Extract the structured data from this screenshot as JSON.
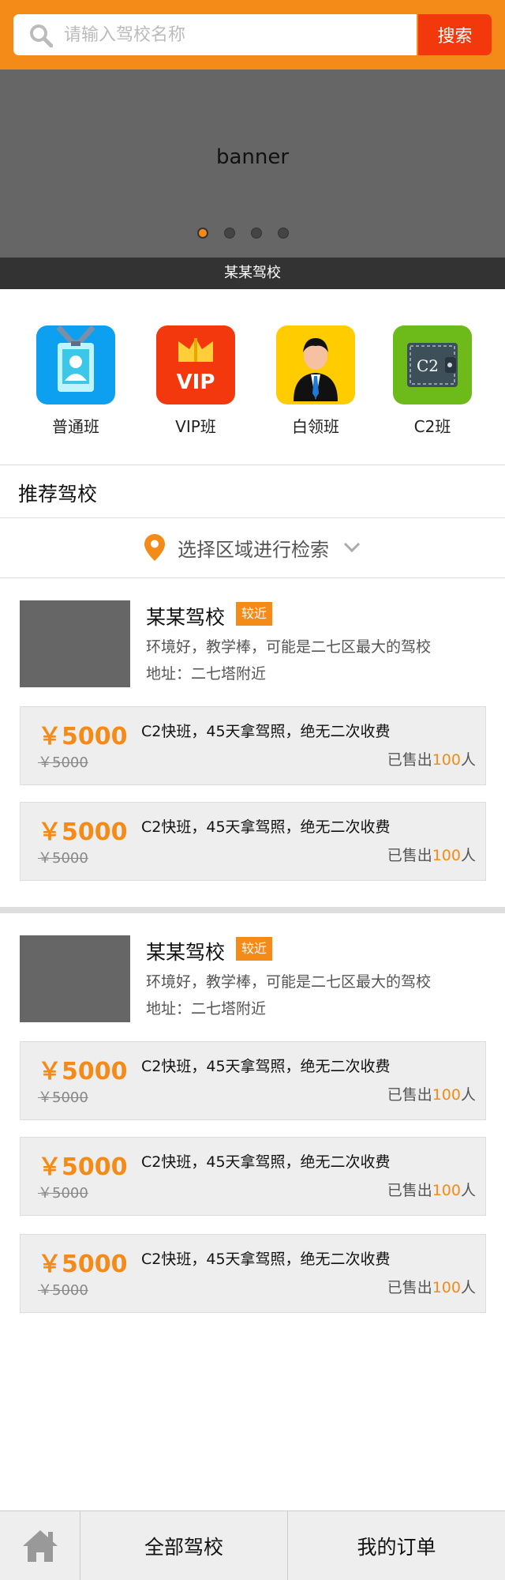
{
  "search": {
    "placeholder": "请输入驾校名称",
    "button_label": "搜索"
  },
  "banner": {
    "text": "banner",
    "caption": "某某驾校",
    "dot_count": 4,
    "active_dot": 1
  },
  "categories": [
    {
      "label": "普通班",
      "icon": "id-badge-icon",
      "color": "#0ea0f0"
    },
    {
      "label": "VIP班",
      "icon": "vip-crown-icon",
      "icon_text": "VIP",
      "color": "#f4380e"
    },
    {
      "label": "白领班",
      "icon": "businessman-icon",
      "color": "#ffcc00"
    },
    {
      "label": "C2班",
      "icon": "c2-wallet-icon",
      "icon_text": "C2",
      "color": "#6cbb1a"
    }
  ],
  "recommend": {
    "title": "推荐驾校"
  },
  "area_filter": {
    "label": "选择区域进行检索"
  },
  "schools": [
    {
      "name": "某某驾校",
      "badge": "较近",
      "desc": "环境好，教学棒，可能是二七区最大的驾校",
      "address": "地址：二七塔附近",
      "offers": [
        {
          "price": "￥5000",
          "old_price": "￥5000",
          "title": "C2快班，45天拿驾照，绝无二次收费",
          "sold_prefix": "已售出",
          "sold_count": "100",
          "sold_suffix": "人"
        },
        {
          "price": "￥5000",
          "old_price": "￥5000",
          "title": "C2快班，45天拿驾照，绝无二次收费",
          "sold_prefix": "已售出",
          "sold_count": "100",
          "sold_suffix": "人"
        }
      ]
    },
    {
      "name": "某某驾校",
      "badge": "较近",
      "desc": "环境好，教学棒，可能是二七区最大的驾校",
      "address": "地址：二七塔附近",
      "offers": [
        {
          "price": "￥5000",
          "old_price": "￥5000",
          "title": "C2快班，45天拿驾照，绝无二次收费",
          "sold_prefix": "已售出",
          "sold_count": "100",
          "sold_suffix": "人"
        },
        {
          "price": "￥5000",
          "old_price": "￥5000",
          "title": "C2快班，45天拿驾照，绝无二次收费",
          "sold_prefix": "已售出",
          "sold_count": "100",
          "sold_suffix": "人"
        },
        {
          "price": "￥5000",
          "old_price": "￥5000",
          "title": "C2快班，45天拿驾照，绝无二次收费",
          "sold_prefix": "已售出",
          "sold_count": "100",
          "sold_suffix": "人"
        }
      ]
    }
  ],
  "footer": {
    "home_icon": "home-icon",
    "tab_all": "全部驾校",
    "tab_orders": "我的订单"
  },
  "colors": {
    "accent": "#f48a17",
    "search_button": "#f4380e"
  }
}
